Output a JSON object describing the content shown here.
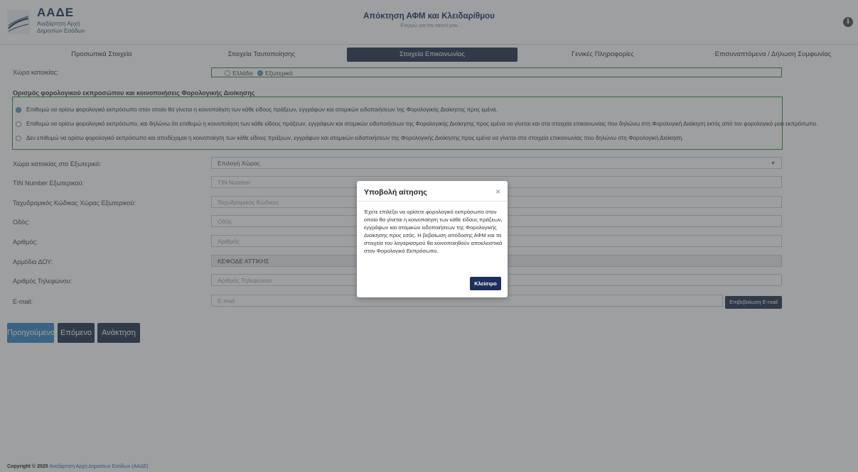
{
  "header": {
    "logo_title": "ΑΑΔΕ",
    "logo_sub_1": "Ανεξάρτητη Αρχή",
    "logo_sub_2": "Δημοσίων Εσόδων",
    "title": "Απόκτηση ΑΦΜ και Κλειδαρίθμου",
    "subtitle": "Ενεργώ για τον εαυτό μου",
    "info_icon": "info-icon"
  },
  "tabs": [
    {
      "label": "Προσωπικά Στοιχεία"
    },
    {
      "label": "Στοιχεία Ταυτοποίησης"
    },
    {
      "label": "Στοιχεία Επικοινωνίας",
      "active": true
    },
    {
      "label": "Γενικές Πληροφορίες"
    },
    {
      "label": "Επισυναπτόμενα / Δήλωση Συμφωνίας"
    }
  ],
  "form": {
    "country_label": "Χώρα κατοικίας:",
    "country_options": [
      "Ελλάδα",
      "Εξωτερικό"
    ],
    "country_selected": "Εξωτερικό",
    "rep_section_title": "Ορισμός φορολογικού εκπροσώπου και κοινοποιήσεις Φορολογικής Διοίκησης",
    "rep_options": [
      "Επιθυμώ να ορίσω φορολογικό εκπρόσωπο στον οποίο θα γίνεται η κοινοποίηση των κάθε είδους πράξεων, εγγράφων και ατομικών ειδοποιήσεων της Φορολογικής Διοίκησης προς εμένα.",
      "Επιθυμώ να ορίσω φορολογικό εκπρόσωπο, και δηλώνω ότι επιθυμώ η κοινοποίηση των κάθε είδους πράξεων, εγγράφων και ατομικών ειδοποιήσεων της Φορολογικής Διοίκησης προς εμένα να γίνεται και στα στοιχεία επικοινωνίας που δηλώνω στη Φορολογική Διοίκηση εκτός από τον φορολογικό μου εκπρόσωπο.",
      "Δεν επιθυμώ να ορίσω φορολογικό εκπρόσωπο και αποδέχομαι η κοινοποίηση των κάθε είδους πράξεων, εγγράφων και ατομικών ειδοποιήσεων της Φορολογικής Διοίκησης προς εμένα να γίνεται στα στοιχεία επικοινωνίας που δηλώνω στη Φορολογική Διοίκηση."
    ],
    "rep_selected_index": 0,
    "fields": [
      {
        "label": "Χώρα κατοικίας στο Εξωτερικό:",
        "placeholder": "Επιλογή Χώρας",
        "kind": "select"
      },
      {
        "label": "TIN Number Εξωτερικού:",
        "placeholder": "TIN Number",
        "kind": "input"
      },
      {
        "label": "Ταχυδρομικός Κώδικας Χώρας Εξωτερικού:",
        "placeholder": "Ταχυδρομικός Κώδικας",
        "kind": "input"
      },
      {
        "label": "Οδός:",
        "placeholder": "Οδός",
        "kind": "input"
      },
      {
        "label": "Αριθμός:",
        "placeholder": "Αριθμός",
        "kind": "input"
      },
      {
        "label": "Αρμόδια ΔΟΥ:",
        "value": "ΚΕΦΟΔΕ ΑΤΤΙΚΗΣ",
        "kind": "readonly"
      },
      {
        "label": "Αριθμός Τηλεφώνου:",
        "placeholder": "Αριθμός Τηλεφώνου",
        "kind": "input"
      },
      {
        "label": "E-mail:",
        "placeholder": "E-mail",
        "kind": "input"
      }
    ],
    "confirm_email_label": "Επιβεβαίωση E-mail"
  },
  "buttons": {
    "previous": "Προηγούμενο",
    "next": "Επόμενο",
    "restore": "Ανάκτηση"
  },
  "footer": {
    "prefix": "Copyright © 2025",
    "link": "Ανεξάρτητη Αρχή Δημοσίων Εσόδων (ΑΑΔΕ)"
  },
  "modal": {
    "title": "Υποβολή αίτησης",
    "close_glyph": "×",
    "body": "Έχετε επιλέξει να ορίσετε φορολογικό εκπρόσωπο στον οποίο θα γίνεται η κοινοποίηση των κάθε είδους πράξεων, εγγράφων και ατομικών ειδοποιήσεων της Φορολογικής Διοίκησης προς εσάς. Η βεβαίωση απόδοσης ΑΦΜ και τα στοιχεία του λογαριασμού θα κοινοποιηθούν αποκλειστικά στον Φορολογικό Εκπρόσωπο.",
    "close_button": "Κλείσιμο"
  }
}
